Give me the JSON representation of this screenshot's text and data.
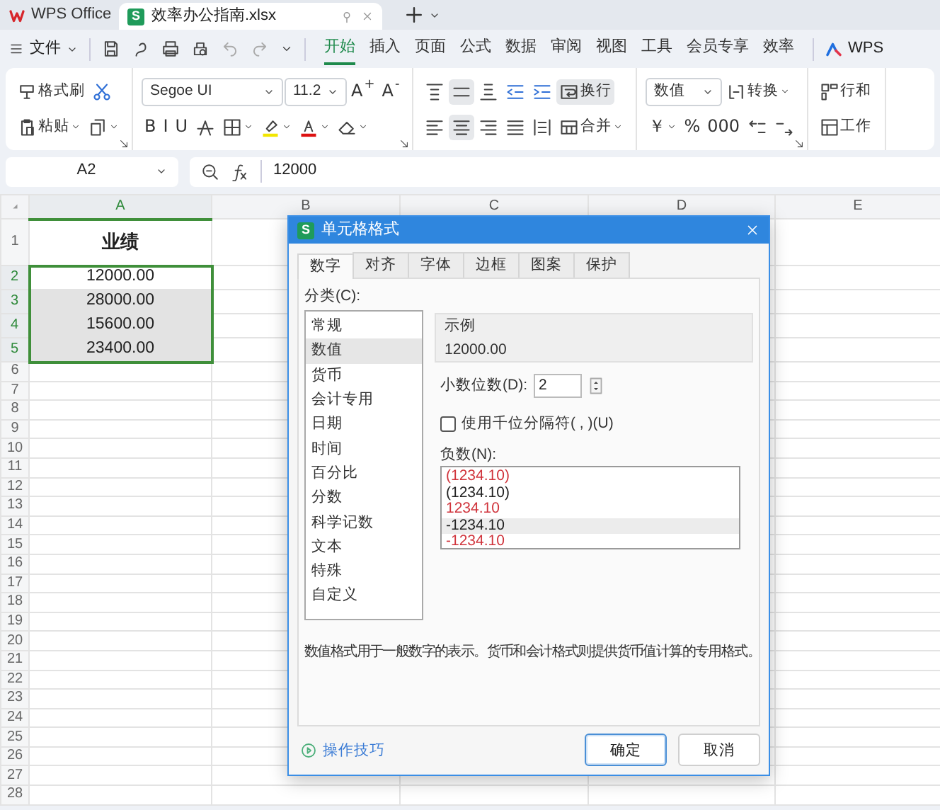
{
  "tab_bar": {
    "app_tab": "WPS Office",
    "file_tab": {
      "badge": "S",
      "label": "效率办公指南.xlsx"
    }
  },
  "menu_bar": {
    "file_menu": "文件",
    "ribbon_tabs": [
      {
        "label": "开始",
        "selected": true
      },
      {
        "label": "插入",
        "selected": false
      },
      {
        "label": "页面",
        "selected": false
      },
      {
        "label": "公式",
        "selected": false
      },
      {
        "label": "数据",
        "selected": false
      },
      {
        "label": "审阅",
        "selected": false
      },
      {
        "label": "视图",
        "selected": false
      },
      {
        "label": "工具",
        "selected": false
      },
      {
        "label": "会员专享",
        "selected": false
      },
      {
        "label": "效率",
        "selected": false
      }
    ],
    "brand": "WPS"
  },
  "ribbon": {
    "groups": [
      {
        "launcher": true,
        "top": [
          {
            "kind": "tool",
            "label": "格式刷"
          },
          {
            "kind": "icon"
          }
        ],
        "bottom": [
          {
            "kind": "tool",
            "label": "粘贴",
            "menu": true
          },
          {
            "kind": "icon",
            "menu": true
          }
        ]
      },
      {
        "launcher": true,
        "top": [
          {
            "kind": "select",
            "label": "Segoe UI"
          },
          {
            "kind": "select",
            "label": "11.2"
          },
          {
            "kind": "glyph",
            "label": "A$^{+}$"
          },
          {
            "kind": "glyph",
            "label": "A$^{-}$"
          }
        ],
        "bottom": [
          {
            "kind": "glyph",
            "label": "B"
          },
          {
            "kind": "glyph",
            "label": "I"
          },
          {
            "kind": "glyph",
            "label": "U"
          },
          {
            "kind": "icon"
          },
          {
            "kind": "icon",
            "menu": true
          },
          {
            "kind": "icon",
            "menu": true
          },
          {
            "kind": "icon",
            "menu": true
          },
          {
            "kind": "icon",
            "menu": true
          }
        ]
      },
      {
        "top": [
          {
            "kind": "icon",
            "selected": false
          },
          {
            "kind": "icon",
            "selected": true
          },
          {
            "kind": "icon",
            "selected": false
          },
          {
            "kind": "icon",
            "selected": false
          },
          {
            "kind": "icon",
            "selected": false
          },
          {
            "kind": "tool",
            "label": "换行",
            "selected": true
          }
        ],
        "bottom": [
          {
            "kind": "icon",
            "selected": false
          },
          {
            "kind": "icon",
            "selected": true
          },
          {
            "kind": "icon",
            "selected": false
          },
          {
            "kind": "icon",
            "selected": false
          },
          {
            "kind": "icon",
            "selected": false
          },
          {
            "kind": "tool",
            "label": "合并",
            "menu": true,
            "selected": false
          }
        ]
      },
      {
        "launcher": true,
        "top": [
          {
            "kind": "select",
            "label": "数值"
          },
          {
            "kind": "tool",
            "label": "转换",
            "menu": true
          }
        ],
        "bottom": [
          {
            "kind": "glyph",
            "label": "￥",
            "menu": true
          },
          {
            "kind": "glyph",
            "label": "%"
          },
          {
            "kind": "glyph",
            "label": "000"
          },
          {
            "kind": "icon"
          },
          {
            "kind": "icon"
          }
        ]
      },
      {
        "top": [
          {
            "kind": "tool",
            "label": "行和"
          }
        ],
        "bottom": [
          {
            "kind": "tool",
            "label": "工作"
          }
        ]
      }
    ]
  },
  "formula_bar": {
    "name_box": "A2",
    "formula": "12000"
  },
  "sheet": {
    "columns": [
      {
        "label": "A",
        "selected": true
      },
      {
        "label": "B",
        "selected": false
      },
      {
        "label": "C",
        "selected": false
      },
      {
        "label": "D",
        "selected": false
      },
      {
        "label": "E",
        "selected": false
      }
    ],
    "rows": [
      {
        "number": "1",
        "kind": "heading",
        "selected": false,
        "cells": [
          "业绩"
        ]
      },
      {
        "number": "2",
        "kind": "data",
        "selected": true,
        "cells": [
          "12000.00"
        ]
      },
      {
        "number": "3",
        "kind": "data",
        "selected": true,
        "cells": [
          "28000.00"
        ]
      },
      {
        "number": "4",
        "kind": "data",
        "selected": true,
        "cells": [
          "15600.00"
        ]
      },
      {
        "number": "5",
        "kind": "data",
        "selected": true,
        "cells": [
          "23400.00"
        ]
      },
      {
        "number": "6",
        "kind": "blank",
        "selected": false
      },
      {
        "number": "7",
        "kind": "blank",
        "selected": false
      },
      {
        "number": "8",
        "kind": "blank",
        "selected": false
      },
      {
        "number": "9",
        "kind": "blank",
        "selected": false
      },
      {
        "number": "10",
        "kind": "blank",
        "selected": false
      },
      {
        "number": "11",
        "kind": "blank",
        "selected": false
      },
      {
        "number": "12",
        "kind": "blank",
        "selected": false
      },
      {
        "number": "13",
        "kind": "blank",
        "selected": false
      },
      {
        "number": "14",
        "kind": "blank",
        "selected": false
      },
      {
        "number": "15",
        "kind": "blank",
        "selected": false
      },
      {
        "number": "16",
        "kind": "blank",
        "selected": false
      },
      {
        "number": "17",
        "kind": "blank",
        "selected": false
      },
      {
        "number": "18",
        "kind": "blank",
        "selected": false
      },
      {
        "number": "19",
        "kind": "blank",
        "selected": false
      },
      {
        "number": "20",
        "kind": "blank",
        "selected": false
      },
      {
        "number": "21",
        "kind": "blank",
        "selected": false
      },
      {
        "number": "22",
        "kind": "blank",
        "selected": false
      },
      {
        "number": "23",
        "kind": "blank",
        "selected": false
      },
      {
        "number": "24",
        "kind": "blank",
        "selected": false
      },
      {
        "number": "25",
        "kind": "blank",
        "selected": false
      },
      {
        "number": "26",
        "kind": "blank",
        "selected": false
      },
      {
        "number": "27",
        "kind": "blank",
        "selected": false
      },
      {
        "number": "28",
        "kind": "blank",
        "selected": false
      }
    ]
  },
  "dialog": {
    "badge": "S",
    "title": "单元格格式",
    "tabs": [
      {
        "label": "数字",
        "selected": true
      },
      {
        "label": "对齐",
        "selected": false
      },
      {
        "label": "字体",
        "selected": false
      },
      {
        "label": "边框",
        "selected": false
      },
      {
        "label": "图案",
        "selected": false
      },
      {
        "label": "保护",
        "selected": false
      }
    ],
    "category_label": "分类(C):",
    "categories": [
      {
        "label": "常规",
        "selected": false
      },
      {
        "label": "数值",
        "selected": true
      },
      {
        "label": "货币",
        "selected": false
      },
      {
        "label": "会计专用",
        "selected": false
      },
      {
        "label": "日期",
        "selected": false
      },
      {
        "label": "时间",
        "selected": false
      },
      {
        "label": "百分比",
        "selected": false
      },
      {
        "label": "分数",
        "selected": false
      },
      {
        "label": "科学记数",
        "selected": false
      },
      {
        "label": "文本",
        "selected": false
      },
      {
        "label": "特殊",
        "selected": false
      },
      {
        "label": "自定义",
        "selected": false
      }
    ],
    "sample_label": "示例",
    "sample_value": "12000.00",
    "decimals_label": "小数位数(D):",
    "decimals_value": "2",
    "thousands": {
      "label": "使用千位分隔符( , )(U)",
      "checked": false
    },
    "negative_label": "负数(N):",
    "negatives": [
      {
        "label": "(1234.10)",
        "color": "#d0343c",
        "selected": false
      },
      {
        "label": "(1234.10)",
        "color": "#222222",
        "selected": false
      },
      {
        "label": "1234.10",
        "color": "#d0343c",
        "selected": false
      },
      {
        "label": "-1234.10",
        "color": "#222222",
        "selected": true
      },
      {
        "label": "-1234.10",
        "color": "#d0343c",
        "selected": false
      }
    ],
    "description": "数值格式用于一般数字的表示。货币和会计格式则提供货币值计算的专用格式。",
    "tips_link": "操作技巧",
    "buttons": [
      {
        "label": "确定",
        "kind": "primary"
      },
      {
        "label": "取消",
        "kind": "secondary"
      }
    ]
  }
}
